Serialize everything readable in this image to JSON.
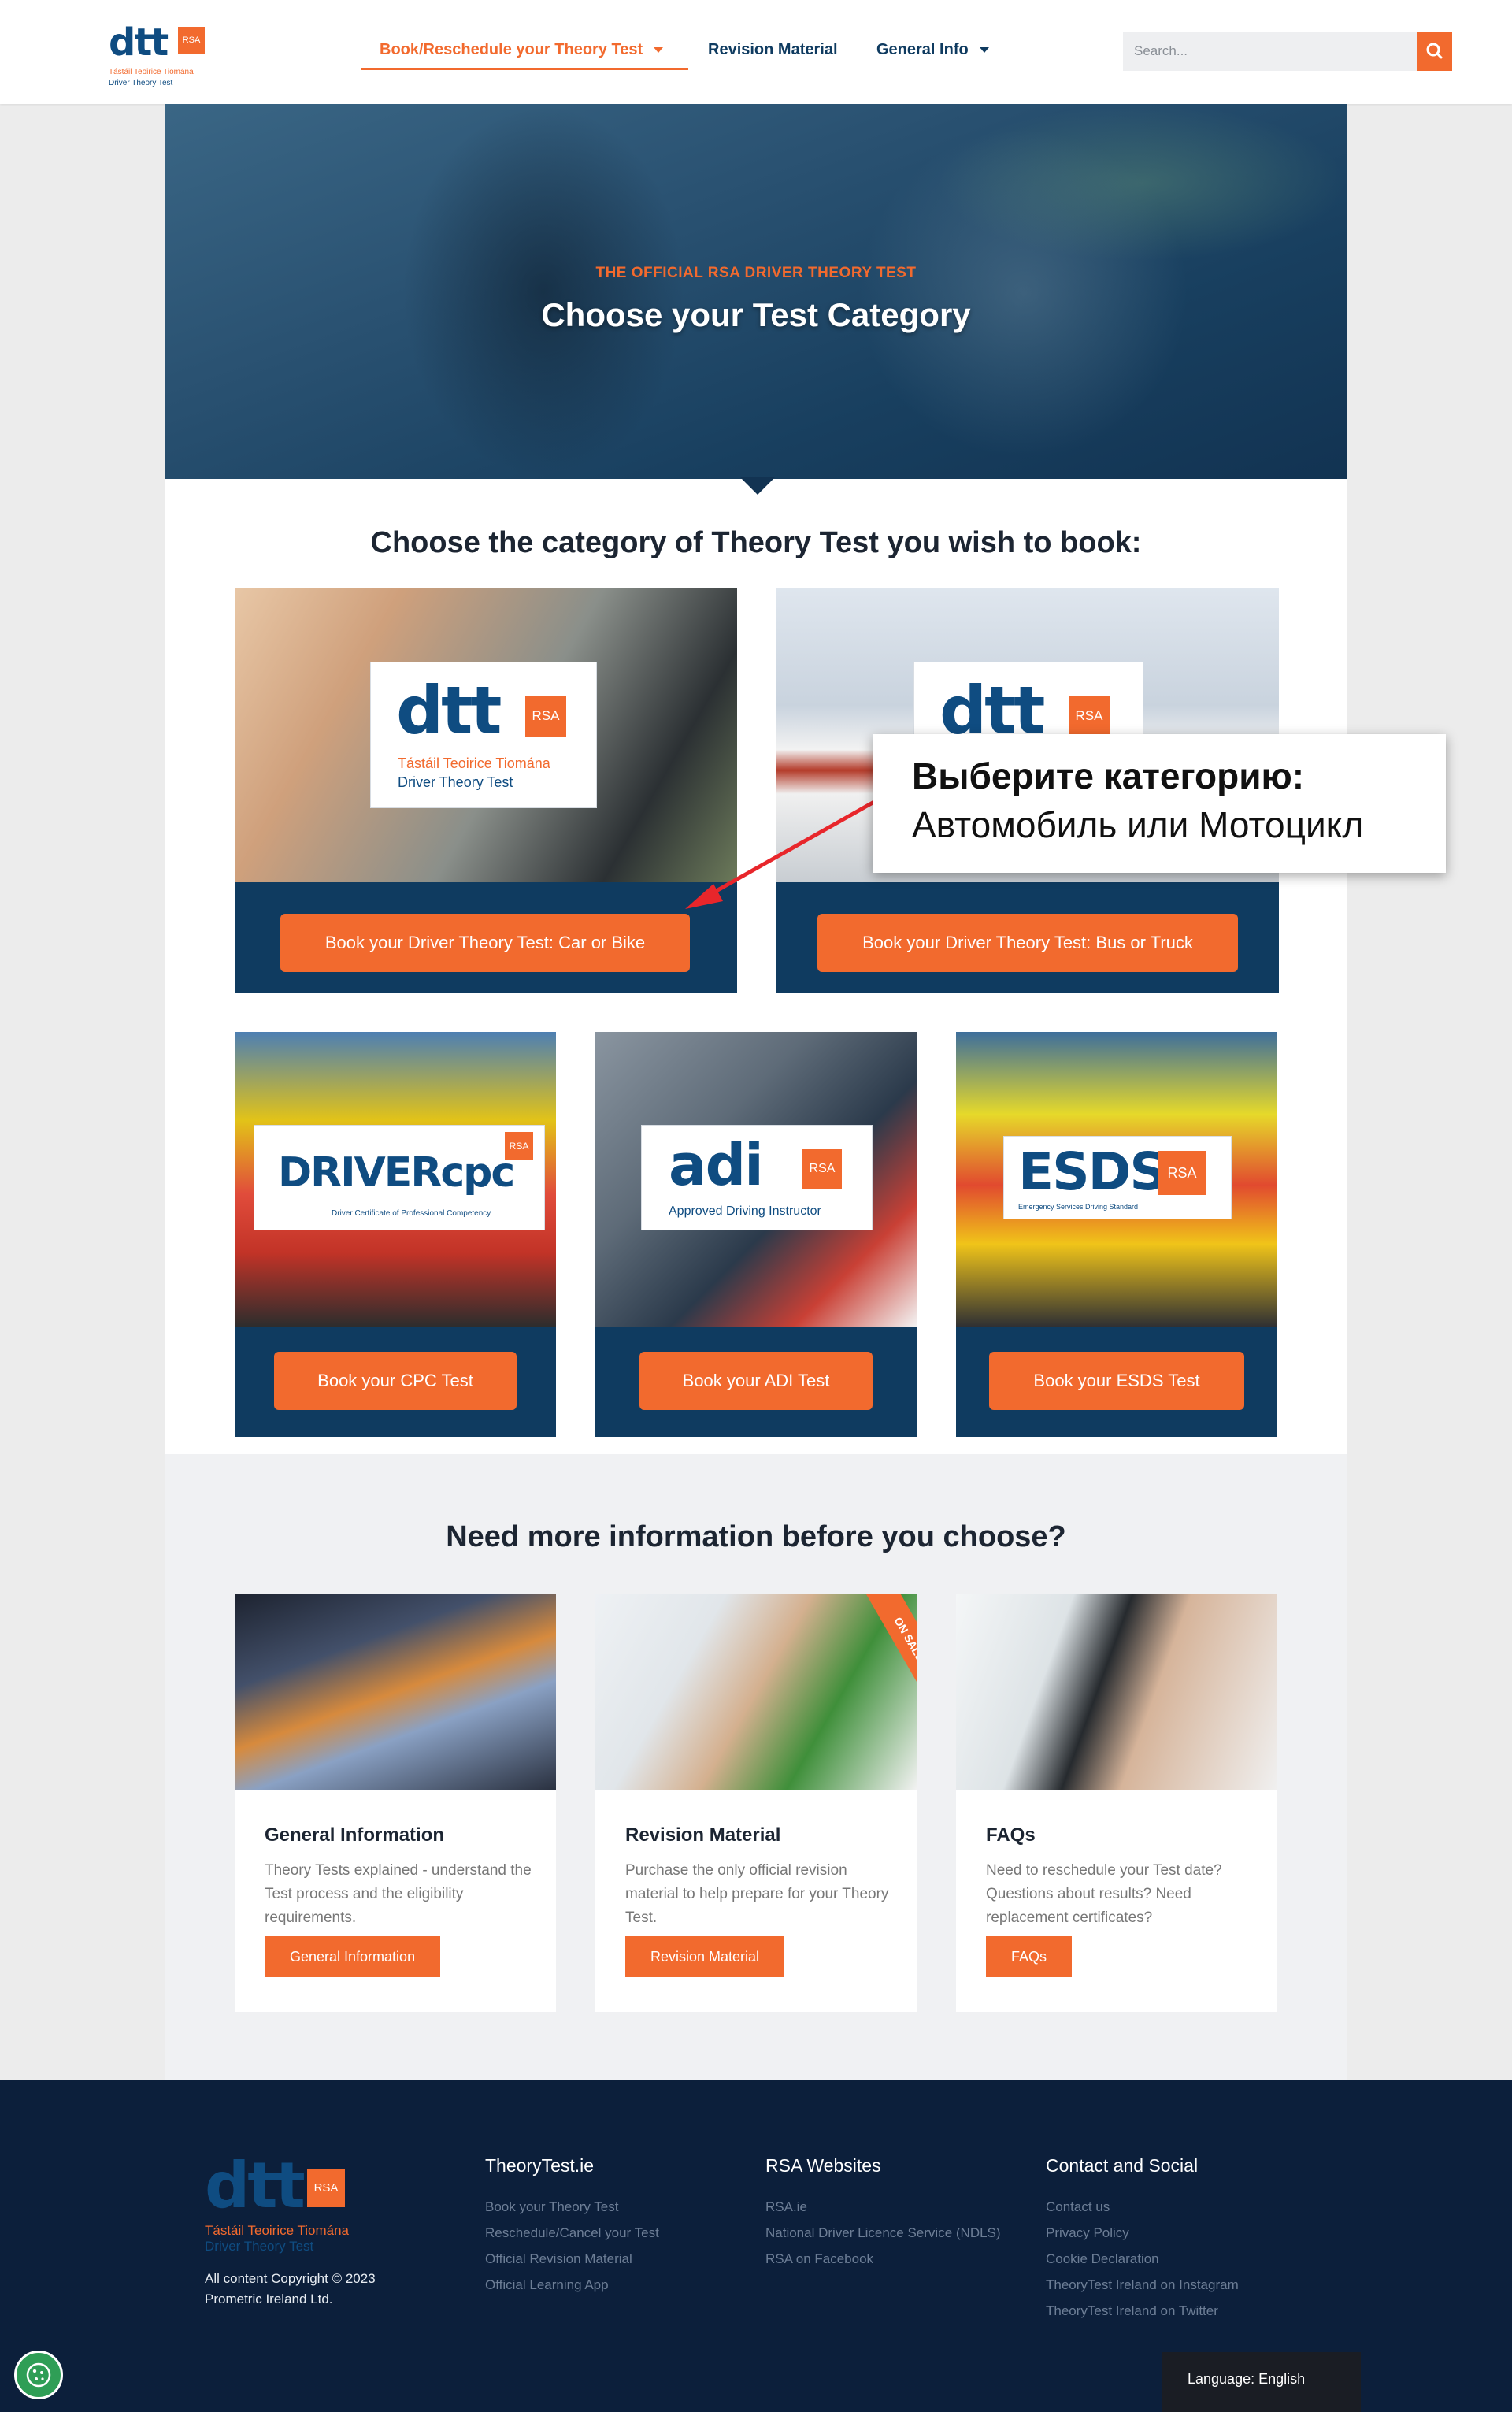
{
  "header": {
    "logo": {
      "mark": "dtt",
      "badge": "RSA",
      "tagline_ga": "Tástáil Teoirice Tiomána",
      "tagline_en": "Driver Theory Test"
    },
    "nav": [
      {
        "label": "Book/Reschedule your Theory Test",
        "has_caret": true,
        "active": true
      },
      {
        "label": "Revision Material",
        "has_caret": false,
        "active": false
      },
      {
        "label": "General Info",
        "has_caret": true,
        "active": false
      }
    ],
    "search": {
      "placeholder": "Search...",
      "value": ""
    }
  },
  "hero": {
    "eyebrow": "THE OFFICIAL RSA DRIVER THEORY TEST",
    "title": "Choose your Test Category"
  },
  "categories": {
    "heading": "Choose the category of Theory Test you wish to book:",
    "cards": [
      {
        "brand": "dtt",
        "badge": "RSA",
        "sub1": "Tástáil Teoirice Tiomána",
        "sub2": "Driver Theory Test",
        "button": "Book your Driver Theory Test: Car or Bike"
      },
      {
        "brand": "dtt",
        "badge": "RSA",
        "button": "Book your Driver Theory Test: Bus or Truck"
      },
      {
        "brand": "DRIVERcpc",
        "badge": "RSA",
        "sub1": "Driver Certificate of Professional Competency",
        "button": "Book your CPC Test"
      },
      {
        "brand": "adi",
        "badge": "RSA",
        "sub1": "Approved Driving Instructor",
        "button": "Book your ADI Test"
      },
      {
        "brand": "ESDS",
        "badge": "RSA",
        "sub1": "Emergency Services Driving Standard",
        "button": "Book your ESDS Test"
      }
    ]
  },
  "callout": {
    "line1": "Выберите категорию:",
    "line2": "Автомобиль или Мотоцикл"
  },
  "info": {
    "heading": "Need more information before you choose?",
    "cards": [
      {
        "title": "General Information",
        "desc": "Theory Tests explained - understand the Test process and the eligibility requirements.",
        "button": "General Information"
      },
      {
        "title": "Revision Material",
        "desc": "Purchase the only official revision material to help prepare for your Theory Test.",
        "button": "Revision Material",
        "ribbon": "ON SALE!"
      },
      {
        "title": "FAQs",
        "desc": "Need to reschedule your Test date? Questions about results? Need replacement certificates?",
        "button": "FAQs"
      }
    ]
  },
  "footer": {
    "logo": {
      "mark": "dtt",
      "badge": "RSA",
      "tagline_ga": "Tástáil Teoirice Tiomána",
      "tagline_en": "Driver Theory Test"
    },
    "copyright_1": "All content Copyright © 2023",
    "copyright_2": "Prometric Ireland Ltd.",
    "columns": [
      {
        "heading": "TheoryTest.ie",
        "links": [
          "Book your Theory Test",
          "Reschedule/Cancel your Test",
          "Official Revision Material",
          "Official Learning App"
        ]
      },
      {
        "heading": "RSA Websites",
        "links": [
          "RSA.ie",
          "National Driver Licence Service (NDLS)",
          "RSA on Facebook"
        ]
      },
      {
        "heading": "Contact and Social",
        "links": [
          "Contact us",
          "Privacy Policy",
          "Cookie Declaration",
          "TheoryTest Ireland on Instagram",
          "TheoryTest Ireland on Twitter"
        ]
      }
    ],
    "language": "Language: English"
  },
  "colors": {
    "accent": "#f26a2e",
    "navy": "#0f3b60",
    "footer": "#0c1f3b"
  }
}
